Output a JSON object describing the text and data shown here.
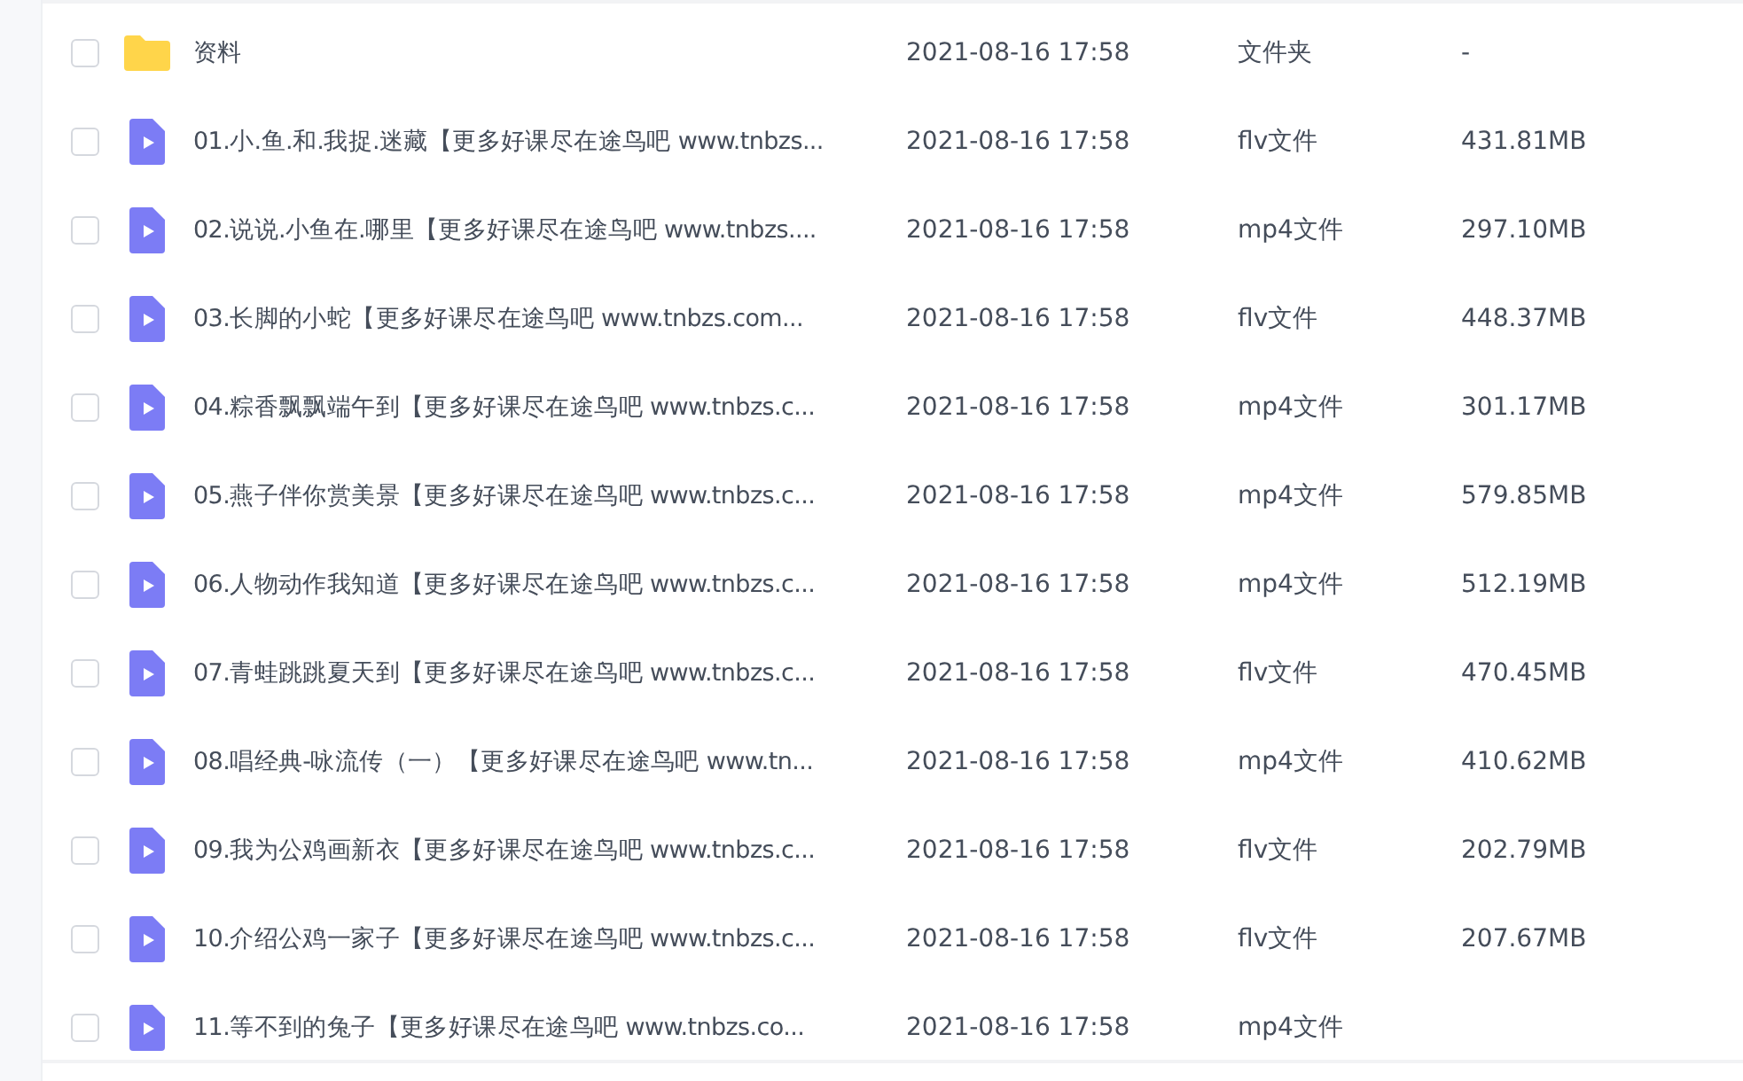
{
  "files": [
    {
      "kind": "folder",
      "name": "资料",
      "modified": "2021-08-16 17:58",
      "type": "文件夹",
      "size": "-",
      "checked": false
    },
    {
      "kind": "video",
      "name": "01.小.鱼.和.我捉.迷藏【更多好课尽在途鸟吧 www.tnbzs...",
      "modified": "2021-08-16 17:58",
      "type": "flv文件",
      "size": "431.81MB",
      "checked": false
    },
    {
      "kind": "video",
      "name": "02.说说.小鱼在.哪里【更多好课尽在途鸟吧 www.tnbzs....",
      "modified": "2021-08-16 17:58",
      "type": "mp4文件",
      "size": "297.10MB",
      "checked": false
    },
    {
      "kind": "video",
      "name": "03.长脚的小蛇【更多好课尽在途鸟吧 www.tnbzs.com...",
      "modified": "2021-08-16 17:58",
      "type": "flv文件",
      "size": "448.37MB",
      "checked": false
    },
    {
      "kind": "video",
      "name": "04.粽香飘飘端午到【更多好课尽在途鸟吧 www.tnbzs.c...",
      "modified": "2021-08-16 17:58",
      "type": "mp4文件",
      "size": "301.17MB",
      "checked": false
    },
    {
      "kind": "video",
      "name": "05.燕子伴你赏美景【更多好课尽在途鸟吧 www.tnbzs.c...",
      "modified": "2021-08-16 17:58",
      "type": "mp4文件",
      "size": "579.85MB",
      "checked": false
    },
    {
      "kind": "video",
      "name": "06.人物动作我知道【更多好课尽在途鸟吧 www.tnbzs.c...",
      "modified": "2021-08-16 17:58",
      "type": "mp4文件",
      "size": "512.19MB",
      "checked": false
    },
    {
      "kind": "video",
      "name": "07.青蛙跳跳夏天到【更多好课尽在途鸟吧 www.tnbzs.c...",
      "modified": "2021-08-16 17:58",
      "type": "flv文件",
      "size": "470.45MB",
      "checked": false
    },
    {
      "kind": "video",
      "name": "08.唱经典-咏流传（一）【更多好课尽在途鸟吧 www.tn...",
      "modified": "2021-08-16 17:58",
      "type": "mp4文件",
      "size": "410.62MB",
      "checked": false
    },
    {
      "kind": "video",
      "name": "09.我为公鸡画新衣【更多好课尽在途鸟吧 www.tnbzs.c...",
      "modified": "2021-08-16 17:58",
      "type": "flv文件",
      "size": "202.79MB",
      "checked": false
    },
    {
      "kind": "video",
      "name": "10.介绍公鸡一家子【更多好课尽在途鸟吧 www.tnbzs.c...",
      "modified": "2021-08-16 17:58",
      "type": "flv文件",
      "size": "207.67MB",
      "checked": false
    },
    {
      "kind": "video",
      "name": "11.等不到的兔子【更多好课尽在途鸟吧 www.tnbzs.co...",
      "modified": "2021-08-16 17:58",
      "type": "mp4文件",
      "checked": false
    }
  ]
}
